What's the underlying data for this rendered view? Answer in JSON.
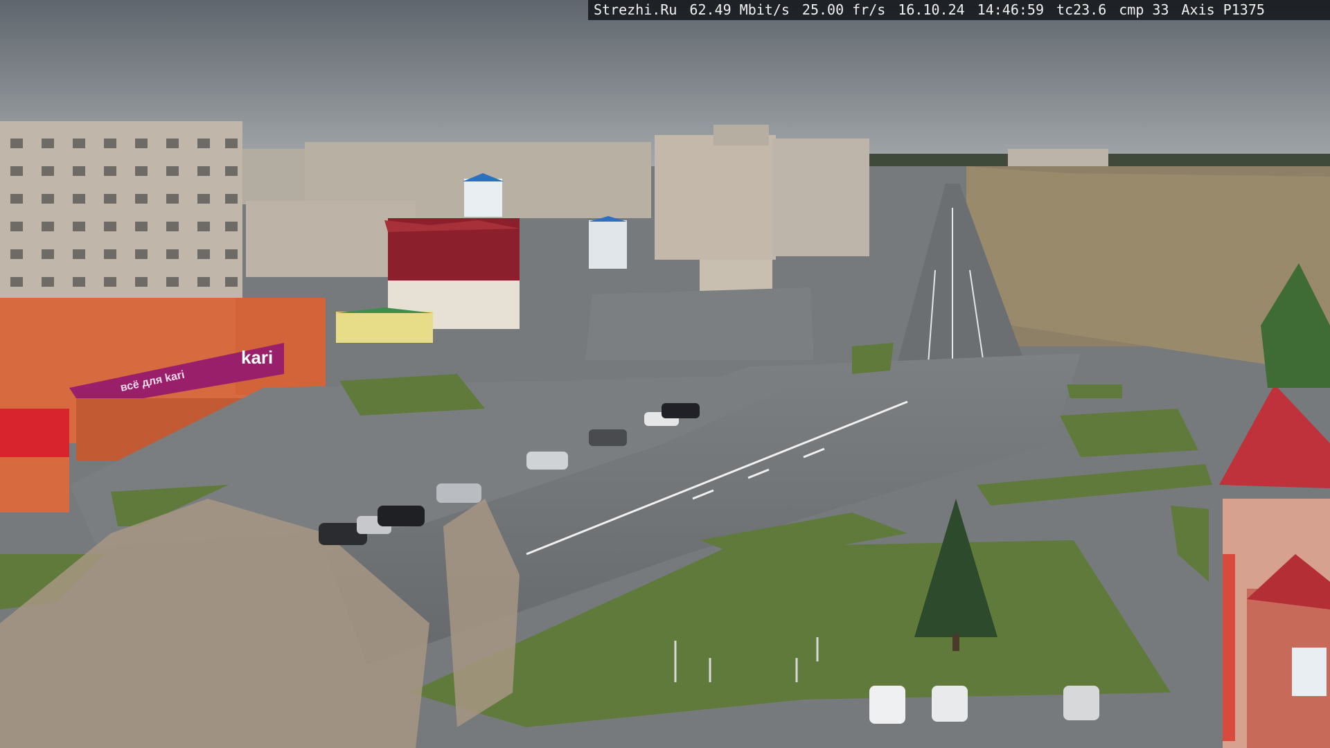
{
  "overlay": {
    "site": "Strezhi.Ru",
    "bitrate": "62.49 Mbit/s",
    "framerate": "25.00 fr/s",
    "date": "16.10.24",
    "time": "14:46:59",
    "tc": "tc23.6",
    "cmp": "cmp 33",
    "camera": "Axis P1375"
  },
  "signs": {
    "store_brand": "kari",
    "store_sub": "всё для kari"
  },
  "colors": {
    "sky": "#7f868c",
    "asphalt": "#6f7375",
    "grass": "#5f7a3a",
    "store_brand": "#9a1f6b",
    "building_orange": "#d86a3f",
    "roof_red": "#c0323b"
  }
}
